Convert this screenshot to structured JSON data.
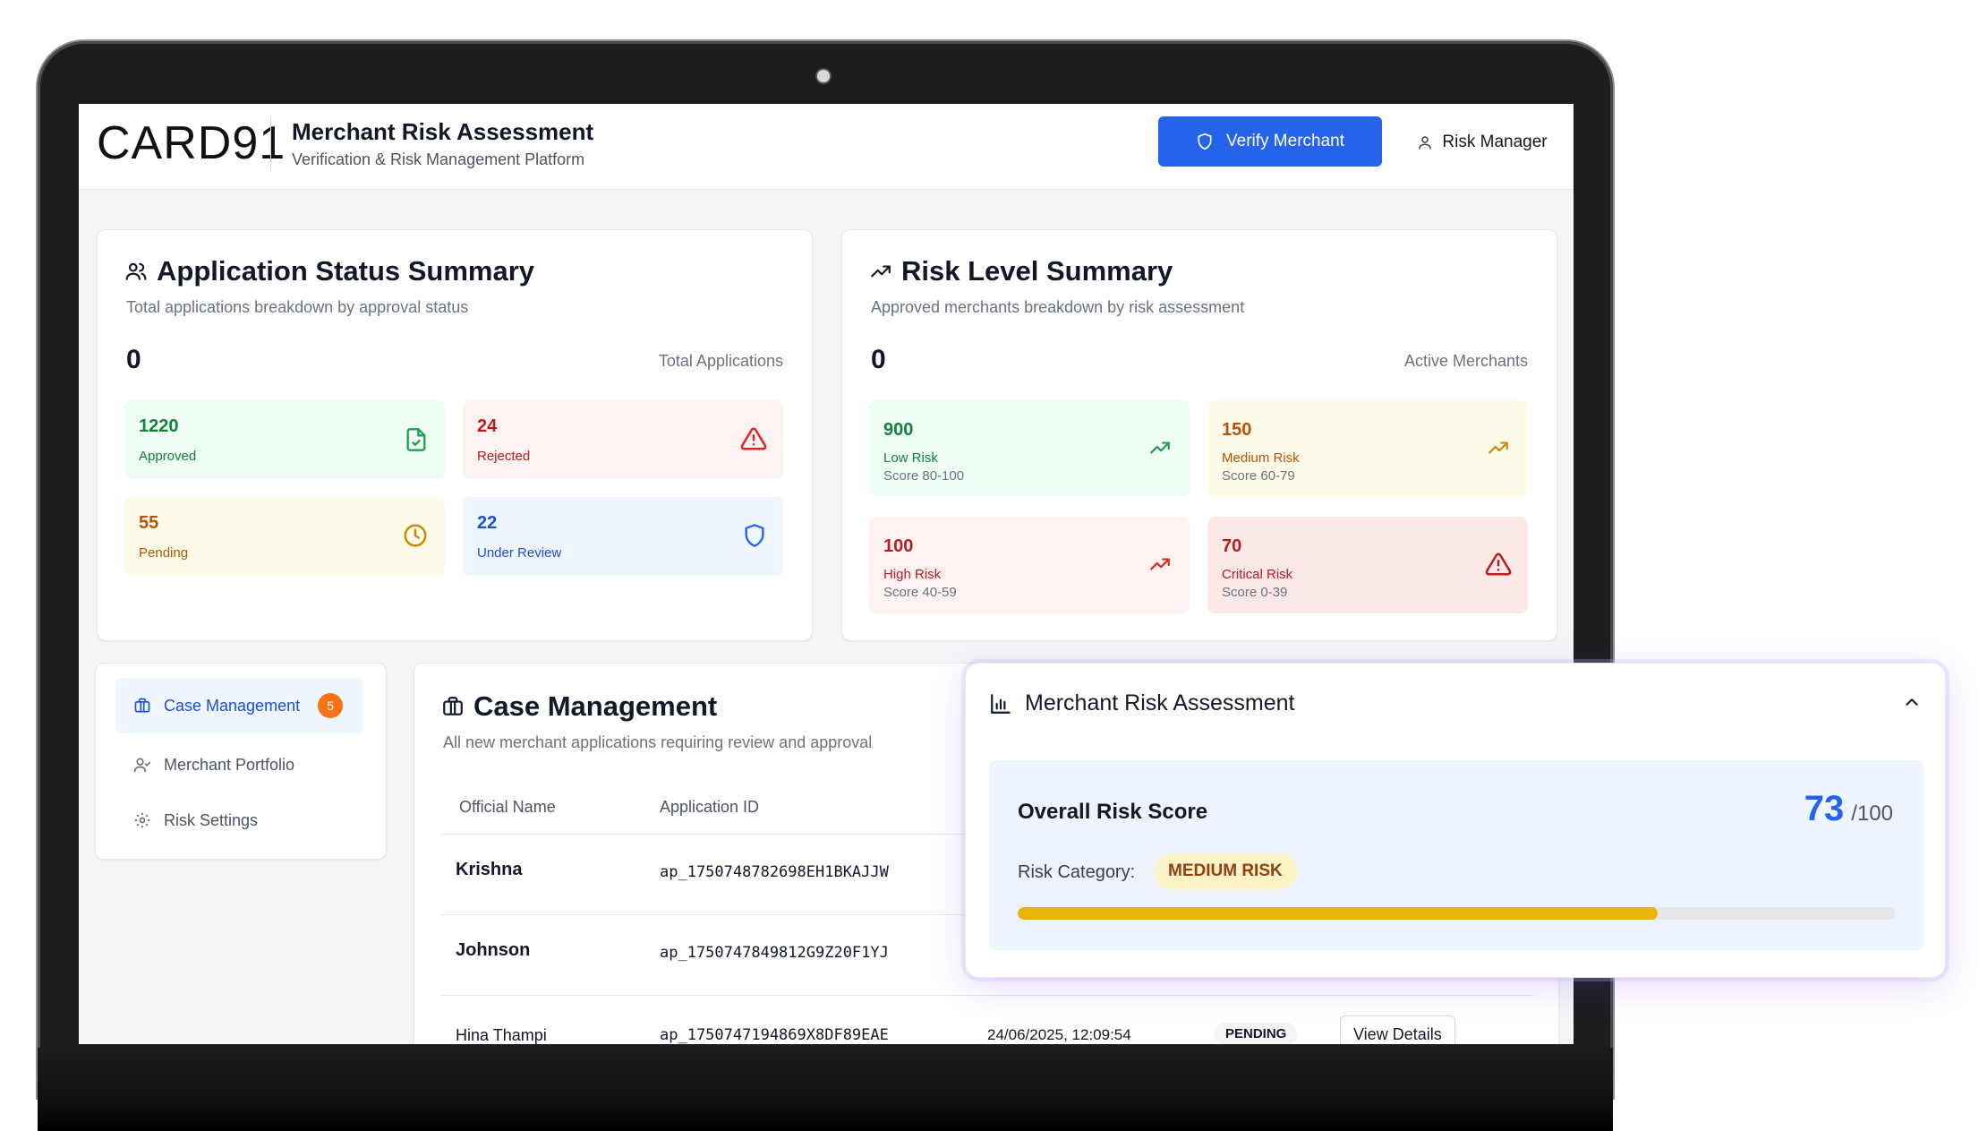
{
  "header": {
    "logo": "CARD91",
    "title": "Merchant Risk Assessment",
    "subtitle": "Verification & Risk Management Platform",
    "verify_button": "Verify Merchant",
    "user_button": "Risk Manager"
  },
  "app_status": {
    "title": "Application Status Summary",
    "subtitle": "Total applications breakdown by approval status",
    "total_value": "0",
    "total_label": "Total Applications",
    "tiles": [
      {
        "value": "1220",
        "label": "Approved",
        "icon": "file-check-icon"
      },
      {
        "value": "24",
        "label": "Rejected",
        "icon": "alert-triangle-icon"
      },
      {
        "value": "55",
        "label": "Pending",
        "icon": "clock-icon"
      },
      {
        "value": "22",
        "label": "Under Review",
        "icon": "shield-icon"
      }
    ]
  },
  "risk_level": {
    "title": "Risk Level Summary",
    "subtitle": "Approved merchants breakdown by risk assessment",
    "total_value": "0",
    "total_label": "Active Merchants",
    "tiles": [
      {
        "value": "900",
        "label": "Low Risk",
        "range": "Score 80-100",
        "color": "#16a34a"
      },
      {
        "value": "150",
        "label": "Medium Risk",
        "range": "Score 60-79",
        "color": "#ca8a04"
      },
      {
        "value": "100",
        "label": "High Risk",
        "range": "Score 40-59",
        "color": "#dc2626"
      },
      {
        "value": "70",
        "label": "Critical Risk",
        "range": "Score 0-39",
        "color": "#b91c1c"
      }
    ]
  },
  "sidebar": {
    "items": [
      {
        "label": "Case Management",
        "badge": "5",
        "active": true
      },
      {
        "label": "Merchant Portfolio"
      },
      {
        "label": "Risk Settings"
      }
    ]
  },
  "case_management": {
    "title": "Case Management",
    "subtitle": "All new merchant applications requiring review and approval",
    "columns": [
      "Official Name",
      "Application ID"
    ],
    "rows": [
      {
        "name": "Krishna",
        "id": "ap_1750748782698EH1BKAJJW"
      },
      {
        "name": "Johnson",
        "id": "ap_1750747849812G9Z20F1YJ"
      },
      {
        "name": "Hina Thampi",
        "id": "ap_1750747194869X8DF89EAE",
        "date": "24/06/2025, 12:09:54",
        "status": "PENDING",
        "action": "View Details"
      }
    ]
  },
  "risk_panel": {
    "title": "Merchant Risk Assessment",
    "score_label": "Overall Risk Score",
    "score": "73",
    "score_max": "/100",
    "score_fraction": 0.73,
    "category_label": "Risk Category:",
    "category": "MEDIUM RISK"
  }
}
